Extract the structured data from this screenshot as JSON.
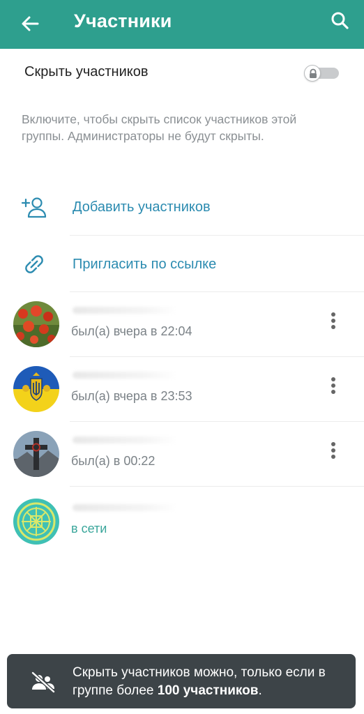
{
  "header": {
    "title": "Участники",
    "back_icon": "arrow-left-icon",
    "search_icon": "search-icon",
    "color": "#2e9f8e"
  },
  "hide_members": {
    "label": "Скрыть участников",
    "toggle_on": false,
    "description": "Включите, чтобы скрыть список участников этой группы. Администраторы не будут скрыты."
  },
  "actions": [
    {
      "label": "Добавить участников",
      "icon": "add-user-icon"
    },
    {
      "label": "Пригласить по ссылке",
      "icon": "link-icon"
    }
  ],
  "members": [
    {
      "name": "",
      "status": "был(а) вчера в 22:04",
      "online": false,
      "avatar": "poppies"
    },
    {
      "name": "",
      "status": "был(а) вчера в 23:53",
      "online": false,
      "avatar": "ukraine-coat-of-arms"
    },
    {
      "name": "",
      "status": "был(а) в 00:22",
      "online": false,
      "avatar": "cross"
    },
    {
      "name": "",
      "status": "в сети",
      "online": true,
      "avatar": "ornament"
    }
  ],
  "toast": {
    "text_before": "Скрыть участников можно, только если в группе более ",
    "text_bold": "100 участников",
    "text_after": ".",
    "icon": "hidden-users-icon"
  },
  "colors": {
    "link_blue": "#2b8bb0",
    "online_teal": "#3aa69b",
    "toast_bg": "#3d4448"
  }
}
